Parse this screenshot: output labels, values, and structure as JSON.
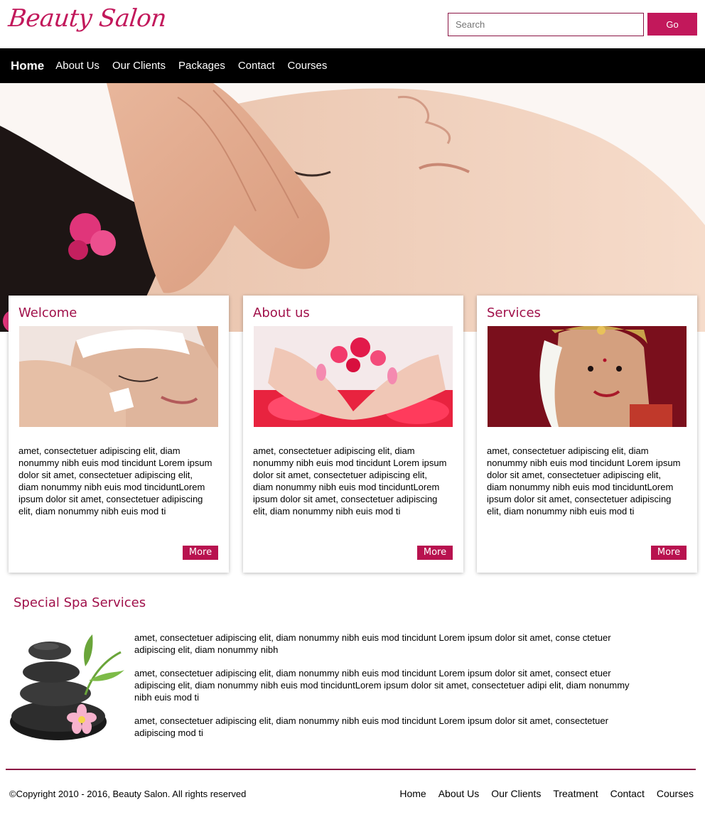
{
  "brand": {
    "logo_text": "Beauty Salon",
    "accent": "#c2185b"
  },
  "search": {
    "placeholder": "Search",
    "button_label": "Go"
  },
  "nav": {
    "items": [
      "Home",
      "About Us",
      "Our Clients",
      "Packages",
      "Contact",
      "Courses"
    ],
    "active": "Home"
  },
  "cards": [
    {
      "title": "Welcome",
      "text": "amet, consectetuer adipiscing elit, diam nonummy nibh euis mod tincidunt Lorem ipsum dolor sit amet, consectetuer adipiscing elit, diam nonummy nibh euis mod tinciduntLorem ipsum dolor sit amet, consectetuer adipiscing elit, diam nonummy nibh euis mod ti",
      "button": "More"
    },
    {
      "title": "About us",
      "text": "amet, consectetuer adipiscing elit, diam nonummy nibh euis mod tincidunt Lorem ipsum dolor sit amet, consectetuer adipiscing elit, diam nonummy nibh euis mod tinciduntLorem ipsum dolor sit amet, consectetuer adipiscing elit, diam nonummy nibh euis mod ti",
      "button": "More"
    },
    {
      "title": "Services",
      "text": "amet, consectetuer adipiscing elit, diam nonummy nibh euis mod tincidunt Lorem ipsum dolor sit amet, consectetuer adipiscing elit, diam nonummy nibh euis mod tinciduntLorem ipsum dolor sit amet, consectetuer adipiscing elit, diam nonummy nibh euis mod ti",
      "button": "More"
    }
  ],
  "special": {
    "title": "Special Spa Services",
    "paragraphs": [
      "amet, consectetuer adipiscing elit, diam nonummy nibh euis mod tincidunt Lorem ipsum dolor sit amet, conse ctetuer adipiscing elit, diam nonummy nibh",
      "amet, consectetuer adipiscing elit, diam nonummy nibh euis mod tincidunt Lorem ipsum dolor sit amet, consect etuer adipiscing elit, diam nonummy nibh euis mod tinciduntLorem ipsum dolor sit amet, consectetuer adipi elit, diam nonummy nibh euis mod ti",
      "amet, consectetuer adipiscing elit, diam nonummy nibh euis mod tincidunt Lorem ipsum dolor sit amet, consectetuer adipiscing mod ti"
    ]
  },
  "footer": {
    "copyright": "©Copyright 2010 - 2016, Beauty Salon. All rights reserved",
    "links": [
      "Home",
      "About Us",
      "Our Clients",
      "Treatment",
      "Contact",
      "Courses"
    ]
  }
}
